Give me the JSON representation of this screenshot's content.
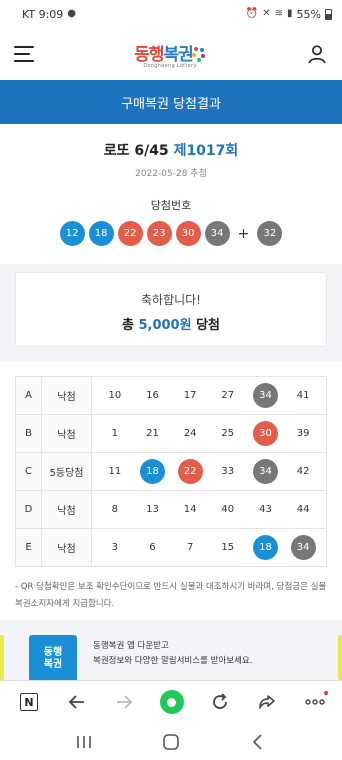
{
  "status_bar": {
    "carrier_time": "KT 9:09",
    "battery": "55%"
  },
  "header": {
    "logo_text_1": "동행",
    "logo_text_2": "복권",
    "logo_sub": "Donghaeng Lottery"
  },
  "page_title": "구매복권 당첨결과",
  "draw": {
    "game": "로또 6/45",
    "round": "제1017회",
    "date": "2022-05-28 추첨",
    "winning_label": "당첨번호",
    "numbers": [
      {
        "n": "12",
        "color": "#1b8fd6"
      },
      {
        "n": "18",
        "color": "#1b8fd6"
      },
      {
        "n": "22",
        "color": "#e35d4d"
      },
      {
        "n": "23",
        "color": "#e35d4d"
      },
      {
        "n": "30",
        "color": "#e35d4d"
      },
      {
        "n": "34",
        "color": "#777777"
      }
    ],
    "plus": "+",
    "bonus": {
      "n": "32",
      "color": "#777777"
    }
  },
  "result": {
    "message": "축하합니다!",
    "prize_prefix": "총",
    "prize_amount": "5,000원",
    "prize_suffix": "당첨"
  },
  "picks": [
    {
      "label": "A",
      "rank": "낙첨",
      "numbers": [
        {
          "n": "10",
          "hit": ""
        },
        {
          "n": "16",
          "hit": ""
        },
        {
          "n": "17",
          "hit": ""
        },
        {
          "n": "27",
          "hit": ""
        },
        {
          "n": "34",
          "hit": "gray"
        },
        {
          "n": "41",
          "hit": ""
        }
      ]
    },
    {
      "label": "B",
      "rank": "낙첨",
      "numbers": [
        {
          "n": "1",
          "hit": ""
        },
        {
          "n": "21",
          "hit": ""
        },
        {
          "n": "24",
          "hit": ""
        },
        {
          "n": "25",
          "hit": ""
        },
        {
          "n": "30",
          "hit": "red"
        },
        {
          "n": "39",
          "hit": ""
        }
      ]
    },
    {
      "label": "C",
      "rank": "5등당첨",
      "numbers": [
        {
          "n": "11",
          "hit": ""
        },
        {
          "n": "18",
          "hit": "blue"
        },
        {
          "n": "22",
          "hit": "red"
        },
        {
          "n": "33",
          "hit": ""
        },
        {
          "n": "34",
          "hit": "gray"
        },
        {
          "n": "42",
          "hit": ""
        }
      ]
    },
    {
      "label": "D",
      "rank": "낙첨",
      "numbers": [
        {
          "n": "8",
          "hit": ""
        },
        {
          "n": "13",
          "hit": ""
        },
        {
          "n": "14",
          "hit": ""
        },
        {
          "n": "40",
          "hit": ""
        },
        {
          "n": "43",
          "hit": ""
        },
        {
          "n": "44",
          "hit": ""
        }
      ]
    },
    {
      "label": "E",
      "rank": "낙첨",
      "numbers": [
        {
          "n": "3",
          "hit": ""
        },
        {
          "n": "6",
          "hit": ""
        },
        {
          "n": "7",
          "hit": ""
        },
        {
          "n": "15",
          "hit": ""
        },
        {
          "n": "18",
          "hit": "blue"
        },
        {
          "n": "34",
          "hit": "gray"
        }
      ]
    }
  ],
  "notice": "- QR 당첨확인은 보조 확인수단이므로 반드시 실물과 대조하시기 바라며, 당첨금은 실물 복권소지자에게 지급합니다.",
  "promo": {
    "icon_line1": "동행",
    "icon_line2": "복권",
    "line1": "동행복권 앱 다운받고",
    "line2": "복권정보와 다양한 알림서비스를 받아보세요."
  },
  "browser_bar": {
    "n_label": "N"
  },
  "icons": [
    "hamburger-icon",
    "user-icon",
    "back-icon",
    "forward-icon",
    "home-dot-icon",
    "refresh-icon",
    "share-icon",
    "more-icon",
    "recent-apps-icon",
    "home-icon",
    "nav-back-icon"
  ]
}
